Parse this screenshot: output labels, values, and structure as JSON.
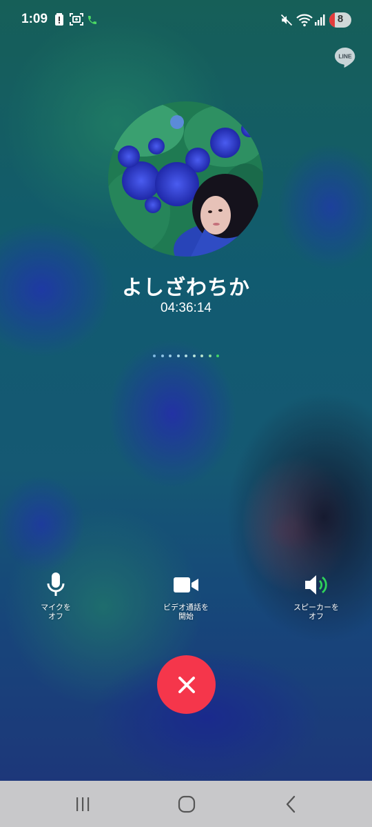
{
  "status_bar": {
    "time": "1:09",
    "battery_level": "8",
    "icons": [
      "battery-alert-icon",
      "screen-capture-icon",
      "phone-call-icon",
      "mute-icon",
      "wifi-icon",
      "signal-icon"
    ]
  },
  "app_badge": {
    "icon": "line-logo-icon",
    "text": "LINE"
  },
  "call": {
    "caller_name": "よしざわちか",
    "duration": "04:36:14"
  },
  "controls": {
    "mic_label": "マイクを\nオフ",
    "video_label": "ビデオ通話を\n開始",
    "speaker_label": "スピーカーを\nオフ"
  },
  "end_call": {
    "icon": "close-icon"
  },
  "nav": {
    "icons": [
      "recent-apps-icon",
      "home-icon",
      "back-icon"
    ]
  },
  "colors": {
    "end_call_red": "#f5364b",
    "speaker_active_green": "#2fd35a",
    "nav_bar_gray": "#c8c8ca"
  }
}
